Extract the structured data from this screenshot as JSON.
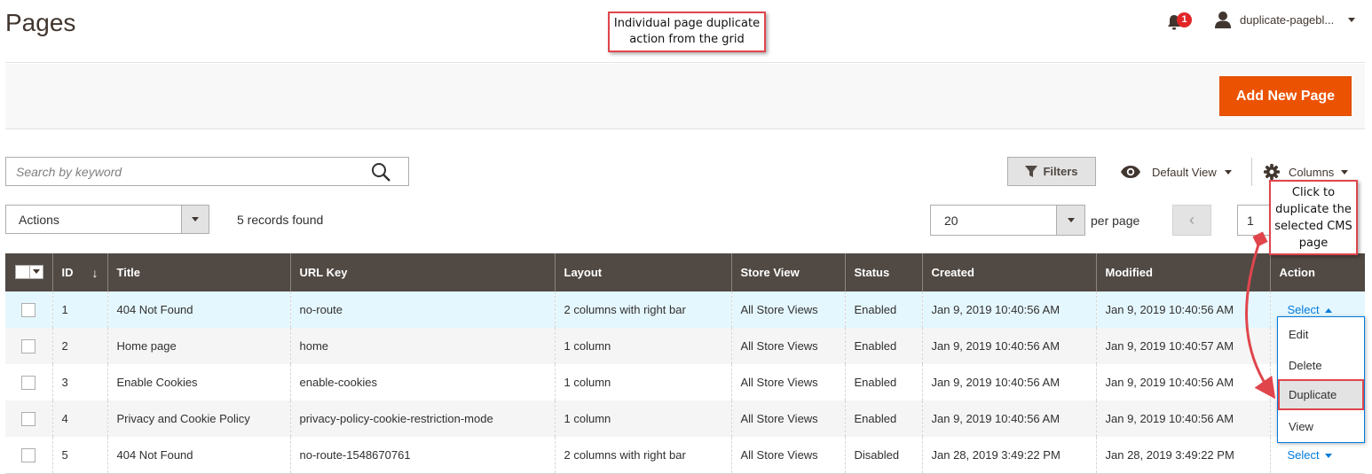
{
  "page": {
    "title": "Pages"
  },
  "callouts": {
    "top_line1": "Individual page duplicate",
    "top_line2": "action from the grid",
    "right_line1": "Click to",
    "right_line2": "duplicate the",
    "right_line3": "selected CMS",
    "right_line4": "page"
  },
  "header": {
    "notification_count": "1",
    "user_label": "duplicate-pagebl..."
  },
  "actions_bar": {
    "add_new_label": "Add New Page"
  },
  "toolbar": {
    "search_placeholder": "Search by keyword",
    "filters_label": "Filters",
    "view_label": "Default View",
    "columns_label": "Columns",
    "mass_actions_label": "Actions",
    "records_found": "5 records found",
    "per_page_value": "20",
    "per_page_label": "per page",
    "current_page": "1"
  },
  "grid": {
    "columns": [
      "ID",
      "Title",
      "URL Key",
      "Layout",
      "Store View",
      "Status",
      "Created",
      "Modified",
      "Action"
    ],
    "sort_indicator": "↓",
    "rows": [
      {
        "id": "1",
        "title": "404 Not Found",
        "url_key": "no-route",
        "layout": "2 columns with right bar",
        "store_view": "All Store Views",
        "status": "Enabled",
        "created": "Jan 9, 2019 10:40:56 AM",
        "modified": "Jan 9, 2019 10:40:56 AM",
        "action": "Select"
      },
      {
        "id": "2",
        "title": "Home page",
        "url_key": "home",
        "layout": "1 column",
        "store_view": "All Store Views",
        "status": "Enabled",
        "created": "Jan 9, 2019 10:40:56 AM",
        "modified": "Jan 9, 2019 10:40:57 AM",
        "action": ""
      },
      {
        "id": "3",
        "title": "Enable Cookies",
        "url_key": "enable-cookies",
        "layout": "1 column",
        "store_view": "All Store Views",
        "status": "Enabled",
        "created": "Jan 9, 2019 10:40:56 AM",
        "modified": "Jan 9, 2019 10:40:56 AM",
        "action": ""
      },
      {
        "id": "4",
        "title": "Privacy and Cookie Policy",
        "url_key": "privacy-policy-cookie-restriction-mode",
        "layout": "1 column",
        "store_view": "All Store Views",
        "status": "Enabled",
        "created": "Jan 9, 2019 10:40:56 AM",
        "modified": "Jan 9, 2019 10:40:56 AM",
        "action": ""
      },
      {
        "id": "5",
        "title": "404 Not Found",
        "url_key": "no-route-1548670761",
        "layout": "2 columns with right bar",
        "store_view": "All Store Views",
        "status": "Disabled",
        "created": "Jan 28, 2019 3:49:22 PM",
        "modified": "Jan 28, 2019 3:49:22 PM",
        "action": "Select"
      }
    ]
  },
  "action_menu": {
    "items": [
      "Edit",
      "Delete",
      "Duplicate",
      "View"
    ],
    "highlighted": "Duplicate"
  },
  "colors": {
    "accent": "#eb5202",
    "grid_header": "#514943",
    "link": "#007bdb",
    "callout_border": "#e0454c",
    "badge": "#e22626"
  },
  "icons": {
    "notification": "bell-icon",
    "user": "user-icon",
    "search": "search-icon",
    "filters": "funnel-icon",
    "view": "eye-icon",
    "columns": "gear-icon"
  }
}
